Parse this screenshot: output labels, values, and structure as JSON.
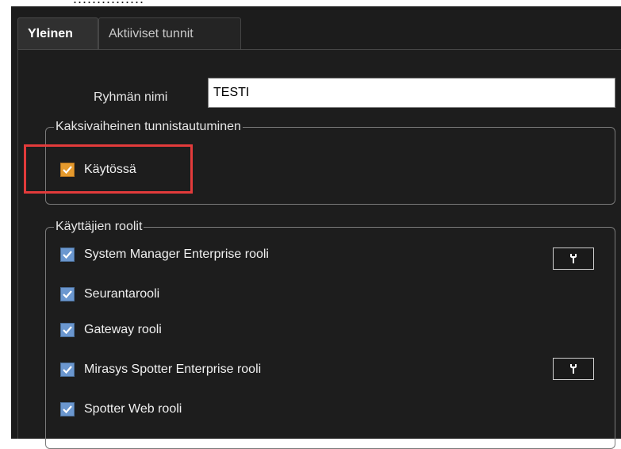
{
  "top_clipped_text": "...............",
  "tabs": [
    {
      "label": "Yleinen",
      "active": true
    },
    {
      "label": "Aktiiviset tunnit",
      "active": false
    }
  ],
  "group_name": {
    "label": "Ryhmän nimi",
    "value": "TESTI"
  },
  "two_factor": {
    "legend": "Kaksivaiheinen tunnistautuminen",
    "enabled_label": "Käytössä",
    "enabled": true,
    "checkbox_color": "#e59a2d"
  },
  "roles": {
    "legend": "Käyttäjien roolit",
    "items": [
      {
        "label": "System Manager Enterprise rooli",
        "checked": true,
        "has_settings": true
      },
      {
        "label": "Seurantarooli",
        "checked": true,
        "has_settings": false
      },
      {
        "label": "Gateway rooli",
        "checked": true,
        "has_settings": false
      },
      {
        "label": "Mirasys Spotter Enterprise rooli",
        "checked": true,
        "has_settings": true
      },
      {
        "label": "Spotter Web rooli",
        "checked": true,
        "has_settings": false
      }
    ],
    "checkbox_color": "#6b97cf",
    "settings_icon": "wrench-icon"
  },
  "highlight_color": "#e33b3b"
}
